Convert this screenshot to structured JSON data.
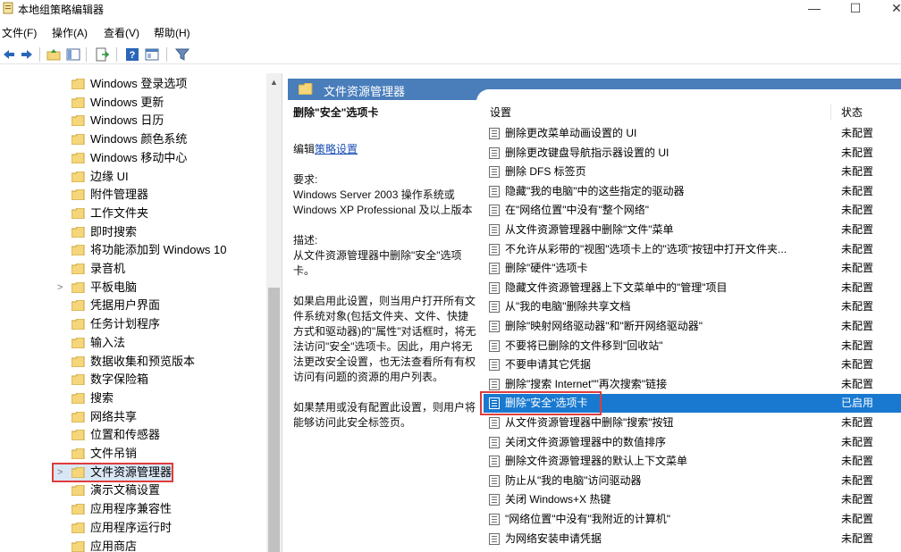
{
  "window": {
    "title": "本地组策略编辑器",
    "controls": {
      "minimize": "—",
      "maximize": "☐",
      "close": "✕"
    }
  },
  "menu": [
    "文件(F)",
    "操作(A)",
    "查看(V)",
    "帮助(H)"
  ],
  "toolbar": [
    "back-icon",
    "forward-icon",
    "up-folder-icon",
    "show-hide-tree-icon",
    "export-list-icon",
    "help-icon",
    "properties-icon",
    "filter-icon"
  ],
  "tree": {
    "items": [
      {
        "label": "Windows 登录选项"
      },
      {
        "label": "Windows 更新"
      },
      {
        "label": "Windows 日历"
      },
      {
        "label": "Windows 颜色系统"
      },
      {
        "label": "Windows 移动中心"
      },
      {
        "label": "边缘 UI"
      },
      {
        "label": "附件管理器"
      },
      {
        "label": "工作文件夹"
      },
      {
        "label": "即时搜索"
      },
      {
        "label": "将功能添加到 Windows 10"
      },
      {
        "label": "录音机"
      },
      {
        "label": "平板电脑",
        "expandable": true
      },
      {
        "label": "凭据用户界面"
      },
      {
        "label": "任务计划程序"
      },
      {
        "label": "输入法"
      },
      {
        "label": "数据收集和预览版本"
      },
      {
        "label": "数字保险箱"
      },
      {
        "label": "搜索"
      },
      {
        "label": "网络共享"
      },
      {
        "label": "位置和传感器"
      },
      {
        "label": "文件吊销"
      },
      {
        "label": "文件资源管理器",
        "expandable": true,
        "selected": true
      },
      {
        "label": "演示文稿设置"
      },
      {
        "label": "应用程序兼容性"
      },
      {
        "label": "应用程序运行时"
      },
      {
        "label": "应用商店"
      }
    ]
  },
  "right": {
    "header": "文件资源管理器",
    "description": {
      "title": "删除\"安全\"选项卡",
      "edit_prefix": "编辑",
      "edit_link": "策略设置",
      "req_label": "要求:",
      "req_text": "Windows Server 2003 操作系统或 Windows XP Professional 及以上版本",
      "desc_label": "描述:",
      "desc_text": "从文件资源管理器中删除\"安全\"选项卡。",
      "para1": "如果启用此设置，则当用户打开所有文件系统对象(包括文件夹、文件、快捷方式和驱动器)的\"属性\"对话框时，将无法访问\"安全\"选项卡。因此，用户将无法更改安全设置，也无法查看所有有权访问有问题的资源的用户列表。",
      "para2": "如果禁用或没有配置此设置，则用户将能够访问此安全标签页。"
    },
    "columns": {
      "setting": "设置",
      "status": "状态"
    },
    "rows": [
      {
        "name": "删除更改菜单动画设置的 UI",
        "status": "未配置"
      },
      {
        "name": "删除更改键盘导航指示器设置的 UI",
        "status": "未配置"
      },
      {
        "name": "删除 DFS 标签页",
        "status": "未配置"
      },
      {
        "name": "隐藏\"我的电脑\"中的这些指定的驱动器",
        "status": "未配置"
      },
      {
        "name": "在\"网络位置\"中没有\"整个网络\"",
        "status": "未配置"
      },
      {
        "name": "从文件资源管理器中删除\"文件\"菜单",
        "status": "未配置"
      },
      {
        "name": "不允许从彩带的\"视图\"选项卡上的\"选项\"按钮中打开文件夹...",
        "status": "未配置"
      },
      {
        "name": "删除\"硬件\"选项卡",
        "status": "未配置"
      },
      {
        "name": "隐藏文件资源管理器上下文菜单中的\"管理\"项目",
        "status": "未配置"
      },
      {
        "name": "从\"我的电脑\"删除共享文档",
        "status": "未配置"
      },
      {
        "name": "删除\"映射网络驱动器\"和\"断开网络驱动器\"",
        "status": "未配置"
      },
      {
        "name": "不要将已删除的文件移到\"回收站\"",
        "status": "未配置"
      },
      {
        "name": "不要申请其它凭据",
        "status": "未配置"
      },
      {
        "name": "删除\"搜索 Internet\"\"再次搜索\"链接",
        "status": "未配置"
      },
      {
        "name": "删除\"安全\"选项卡",
        "status": "已启用",
        "selected": true
      },
      {
        "name": "从文件资源管理器中删除\"搜索\"按钮",
        "status": "未配置"
      },
      {
        "name": "关闭文件资源管理器中的数值排序",
        "status": "未配置"
      },
      {
        "name": "删除文件资源管理器的默认上下文菜单",
        "status": "未配置"
      },
      {
        "name": "防止从\"我的电脑\"访问驱动器",
        "status": "未配置"
      },
      {
        "name": "关闭 Windows+X 热键",
        "status": "未配置"
      },
      {
        "name": "\"网络位置\"中没有\"我附近的计算机\"",
        "status": "未配置"
      },
      {
        "name": "为网络安装申请凭据",
        "status": "未配置"
      }
    ]
  },
  "colors": {
    "selection": "#1979d1",
    "header": "#4a7ebb",
    "highlight_box": "#e03c3c",
    "folder": "#f5d67b"
  }
}
